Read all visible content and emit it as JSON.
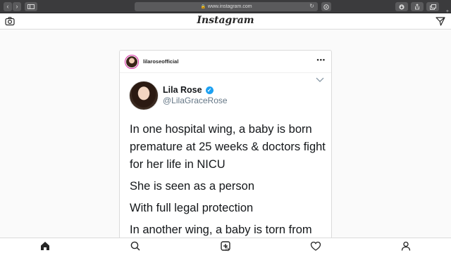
{
  "browser": {
    "url": "www.instagram.com"
  },
  "header": {
    "logo": "Instagram",
    "icons": [
      "camera-icon",
      "direct-message-icon"
    ]
  },
  "post": {
    "username": "lilaroseofficial",
    "more": "•••",
    "tweet": {
      "name": "Lila Rose",
      "handle": "@LilaGraceRose",
      "lines": [
        "In one hospital wing, a baby is born",
        "premature at 25 weeks & doctors fight",
        "for her life in NICU",
        "She is seen as a person",
        "With full legal protection",
        "In another wing, a baby is torn from"
      ]
    }
  },
  "tabbar": {
    "icons": [
      "home-icon",
      "search-icon",
      "new-post-icon",
      "heart-icon",
      "profile-icon"
    ]
  },
  "colors": {
    "verified": "#1da1f2",
    "chrome": "#3b3b3d"
  }
}
